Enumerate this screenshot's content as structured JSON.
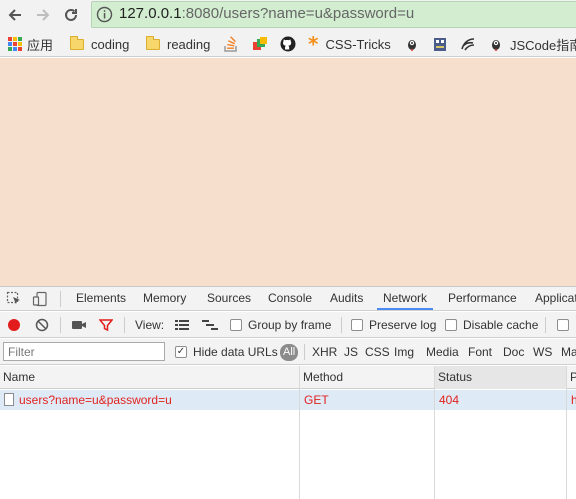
{
  "address_bar": {
    "host": "127.0.0.1",
    "rest": ":8080/users?name=u&password=u"
  },
  "bookmarks": [
    {
      "label": "应用",
      "icon": "apps-grid-icon"
    },
    {
      "label": "coding",
      "icon": "folder-icon"
    },
    {
      "label": "reading",
      "icon": "folder-icon"
    },
    {
      "label": "",
      "icon": "stackoverflow-icon"
    },
    {
      "label": "",
      "icon": "colorful-cube-icon"
    },
    {
      "label": "",
      "icon": "github-icon"
    },
    {
      "label": "CSS-Tricks",
      "icon": "css-tricks-star-icon"
    },
    {
      "label": "",
      "icon": "bird-icon"
    },
    {
      "label": "",
      "icon": "robot-icon"
    },
    {
      "label": "",
      "icon": "swirl-icon"
    },
    {
      "label": "JSCode指南",
      "icon": "bird-icon"
    }
  ],
  "devtools": {
    "tabs": [
      "Elements",
      "Memory",
      "Sources",
      "Console",
      "Audits",
      "Network",
      "Performance",
      "Applicati"
    ],
    "active_tab": "Network",
    "toolbar": {
      "view_label": "View:",
      "group_by_frame": "Group by frame",
      "preserve_log": "Preserve log",
      "disable_cache": "Disable cache"
    },
    "filter": {
      "placeholder": "Filter",
      "hide_data_urls": "Hide data URLs",
      "types": [
        "All",
        "XHR",
        "JS",
        "CSS",
        "Img",
        "Media",
        "Font",
        "Doc",
        "WS",
        "Ma"
      ]
    },
    "table": {
      "columns": [
        "Name",
        "Method",
        "Status",
        "P"
      ],
      "rows": [
        {
          "name": "users?name=u&password=u",
          "method": "GET",
          "status": "404",
          "extra": "h"
        }
      ]
    }
  },
  "colors": {
    "page_background": "#f7dfce",
    "address_bar": "#d2edd0",
    "error_text": "#e0231f",
    "active_tab_underline": "#4a8af4",
    "selected_row": "#dfeaf7"
  }
}
